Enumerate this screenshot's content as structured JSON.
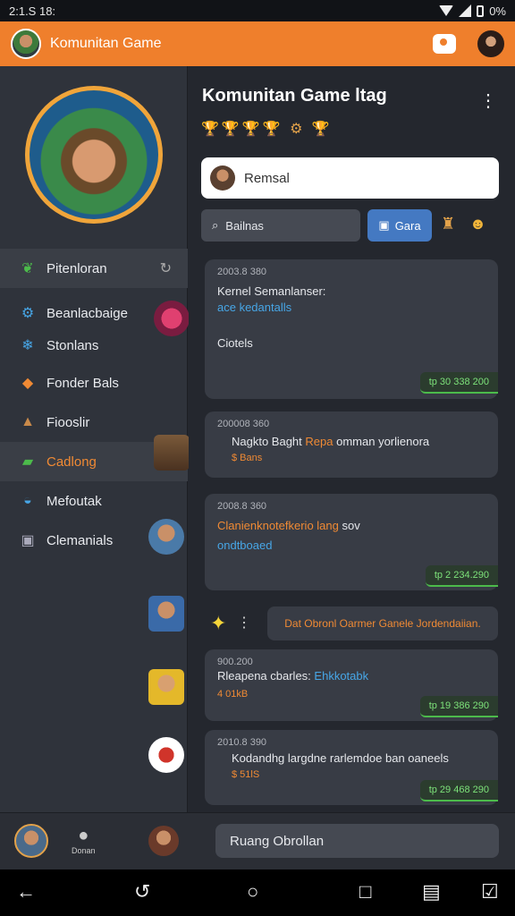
{
  "status_bar": {
    "time": "2:1.S 18:",
    "battery": "0%"
  },
  "app_bar": {
    "title": "Komunitan Game"
  },
  "sidebar": {
    "items": [
      {
        "label": "Pitenloran",
        "icon": "heart-wings-icon",
        "glyph": "❦"
      },
      {
        "label": "Beanlacbaige",
        "icon": "gamepad-icon",
        "glyph": "⚙"
      },
      {
        "label": "Stonlans",
        "icon": "snowflake-icon",
        "glyph": "❄"
      },
      {
        "label": "Fonder Bals",
        "icon": "diamond-flame-icon",
        "glyph": "◆"
      },
      {
        "label": "Fiooslir",
        "icon": "boot-icon",
        "glyph": "▲"
      },
      {
        "label": "Cadlong",
        "icon": "controller-icon",
        "glyph": "▰"
      },
      {
        "label": "Mefoutak",
        "icon": "hat-icon",
        "glyph": "◒"
      },
      {
        "label": "Clemanials",
        "icon": "briefcase-icon",
        "glyph": "▣"
      }
    ]
  },
  "main": {
    "title": "Komunitan Game ltag",
    "badges": "🏆🏆🏆🏆 ⚙ 🏆",
    "search": {
      "value": "Remsal"
    },
    "filter": {
      "label": "Bailnas",
      "game_label": "Gara"
    }
  },
  "messages": [
    {
      "ts": "2003.8 380",
      "line1": "Kernel Semanlanser:",
      "line2": "ace kedantalls",
      "line3": "Ciotels",
      "price": "tp 30 338 200"
    },
    {
      "ts": "200008 360",
      "line1": "Nagkto Baght",
      "line1b": "Repa",
      "line1c": "omman yorlienora",
      "line2": "$ Bans"
    },
    {
      "ts": "2008.8 360",
      "line1": "Clanienknotefkerio lang",
      "line1b": "sov",
      "line2": "ondtboaed",
      "price": "tp 2 234.290"
    },
    {
      "ts": "900.200",
      "line1": "Rleapena cbarles:",
      "line1b": "Ehkkotabk",
      "line2": "4 01kB",
      "price": "tp 19 386 290"
    },
    {
      "ts": "2010.8 390",
      "line1": "Kodandhg largdne rarlemdoe ban oaneels",
      "line2": "$ 51lS",
      "price": "tp 29 468 290"
    }
  ],
  "center_chip": "Dat Obronl Oarmer Ganele Jordendaiian.",
  "bottom_bar": {
    "tab_label": "Donan",
    "compose_label": "Ruang Obrollan"
  },
  "colors": {
    "accent": "#ef7f2c",
    "blue": "#4479c2",
    "green": "#4cbb4b"
  }
}
